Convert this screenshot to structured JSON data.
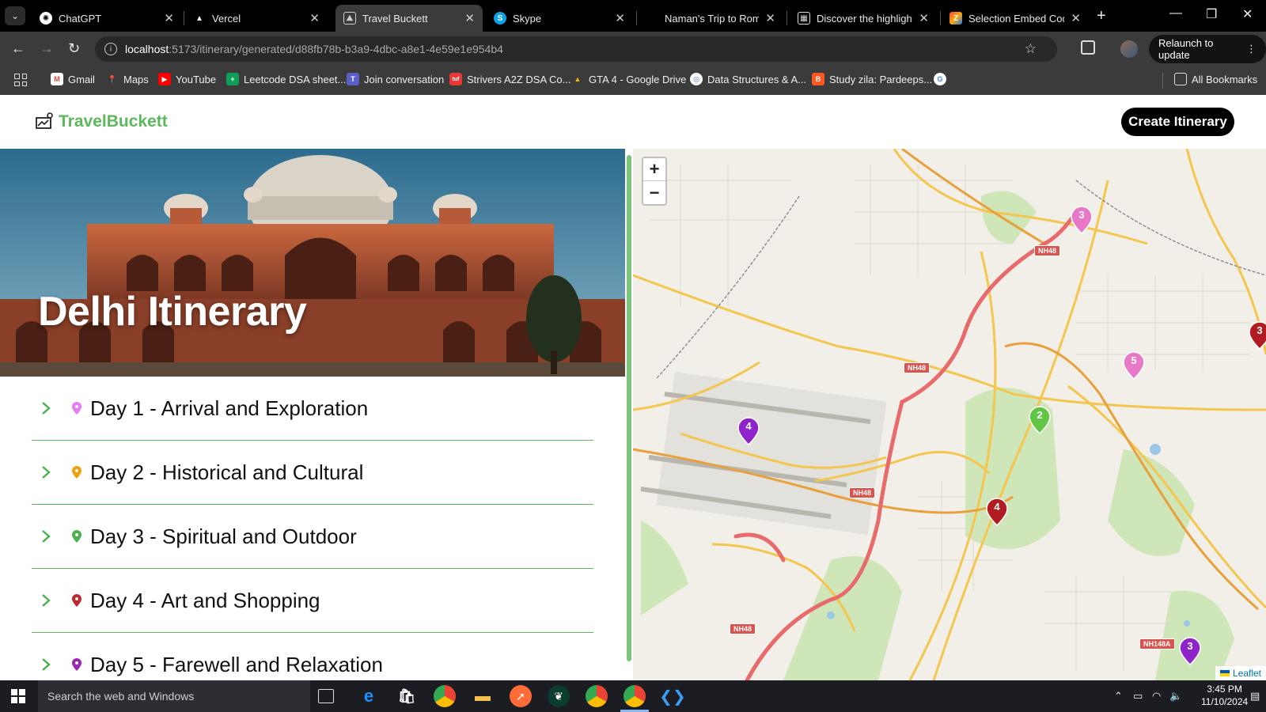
{
  "browser": {
    "tabs": [
      {
        "title": "ChatGPT",
        "favicon": "chatgpt-icon",
        "active": false
      },
      {
        "title": "Vercel",
        "favicon": "vercel-icon",
        "active": false
      },
      {
        "title": "Travel Buckett",
        "favicon": "travel-buckett-icon",
        "active": true
      },
      {
        "title": "Skype",
        "favicon": "skype-icon",
        "active": false
      },
      {
        "title": "Naman's Trip to Rome,",
        "favicon": "none",
        "active": false
      },
      {
        "title": "Discover the highlights",
        "favicon": "document-icon",
        "active": false
      },
      {
        "title": "Selection Embed Code",
        "favicon": "selection-icon",
        "active": false
      }
    ],
    "url": {
      "host": "localhost",
      "path": ":5173/itinerary/generated/d88fb78b-b3a9-4dbc-a8e1-4e59e1e954b4"
    },
    "relaunch_label": "Relaunch to update",
    "bookmarks": [
      {
        "label": "Gmail",
        "icon": "gmail-icon",
        "color": "#ea4335"
      },
      {
        "label": "Maps",
        "icon": "maps-icon",
        "color": "#34a853"
      },
      {
        "label": "YouTube",
        "icon": "youtube-icon",
        "color": "#ff0000"
      },
      {
        "label": "Leetcode DSA sheet...",
        "icon": "sheets-icon",
        "color": "#0f9d58"
      },
      {
        "label": "Join conversation",
        "icon": "teams-icon",
        "color": "#5b5fc7"
      },
      {
        "label": "Strivers A2Z DSA Co...",
        "icon": "tuf-icon",
        "color": "#e53935"
      },
      {
        "label": "GTA 4 - Google Drive",
        "icon": "drive-icon",
        "color": "#fbbc04"
      },
      {
        "label": "Data Structures & A...",
        "icon": "globe-icon",
        "color": "#4a6fa5"
      },
      {
        "label": "Study zila: Pardeeps...",
        "icon": "blogger-icon",
        "color": "#ff5722"
      }
    ],
    "all_bookmarks_label": "All Bookmarks"
  },
  "app": {
    "brand": "TravelBuckett",
    "create_button": "Create Itinerary",
    "hero_title": "Delhi Itinerary",
    "days": [
      {
        "label": "Day 1 - Arrival and Exploration",
        "pin_color": "#e879f9"
      },
      {
        "label": "Day 2 - Historical and Cultural",
        "pin_color": "#f59e0b"
      },
      {
        "label": "Day 3 - Spiritual and Outdoor",
        "pin_color": "#4caf50"
      },
      {
        "label": "Day 4 - Art and Shopping",
        "pin_color": "#c0262d"
      },
      {
        "label": "Day 5 - Farewell and Relaxation",
        "pin_color": "#9c27b0"
      }
    ]
  },
  "map": {
    "zoom_in": "+",
    "zoom_out": "−",
    "markers": [
      {
        "label": "3",
        "color": "#e879c7"
      },
      {
        "label": "3",
        "color": "#b01c22"
      },
      {
        "label": "5",
        "color": "#e879c7"
      },
      {
        "label": "2",
        "color": "#62c544"
      },
      {
        "label": "4",
        "color": "#8e24c9"
      },
      {
        "label": "4",
        "color": "#b01c22"
      },
      {
        "label": "3",
        "color": "#8e24c9"
      }
    ],
    "road_labels": [
      "NH48",
      "NH48",
      "NH48",
      "NH48",
      "NH148A"
    ],
    "attribution": "Leaflet"
  },
  "taskbar": {
    "search_placeholder": "Search the web and Windows",
    "time": "3:45 PM",
    "date": "11/10/2024"
  }
}
